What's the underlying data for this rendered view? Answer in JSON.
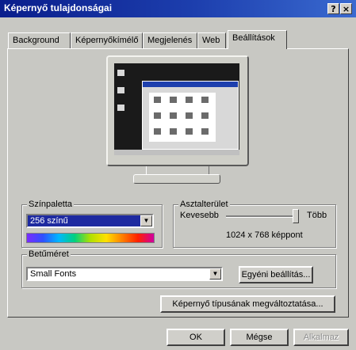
{
  "window": {
    "title": "Képernyő tulajdonságai",
    "help_label": "?",
    "close_label": "×"
  },
  "tabs": [
    {
      "label": "Background"
    },
    {
      "label": "Képernyőkímélő"
    },
    {
      "label": "Megjelenés"
    },
    {
      "label": "Web"
    },
    {
      "label": "Beállítások"
    }
  ],
  "active_tab": "Beállítások",
  "color_palette": {
    "legend": "Színpaletta",
    "selected": "256 színű"
  },
  "desktop_area": {
    "legend": "Asztalterület",
    "less_label": "Kevesebb",
    "more_label": "Több",
    "resolution": "1024 x 768 képpont",
    "slider_value": 1.0
  },
  "font_size": {
    "legend": "Betűméret",
    "selected": "Small Fonts",
    "custom_button": "Egyéni beállítás..."
  },
  "change_display_button": "Képernyő típusának megváltoztatása...",
  "footer": {
    "ok": "OK",
    "cancel": "Mégse",
    "apply": "Alkalmaz"
  },
  "colors": {
    "title_bar": "#0a1e8c",
    "dialog_bg": "#c8c8c3",
    "palette_selection": "#1e2aa0"
  }
}
